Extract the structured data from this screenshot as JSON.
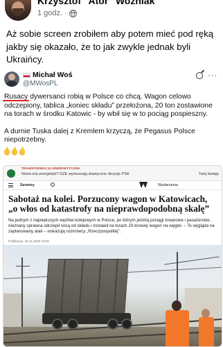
{
  "post": {
    "author": "Krzysztof \"Ator\" Woźniak",
    "time": "1 godz.",
    "text": "Aż sobie screen zrobiłem aby potem mieć pod ręką jakby się okazało, że to jak zwykle jednak byli Ukraińcy."
  },
  "tweet": {
    "name": "Michał Woś",
    "handle": "@MWosPL",
    "para1_highlight": "Rusacy",
    "para1_rest": " dywersanci robią w Polsce co chcą. Wagon celowo odczepiony, tablica „koniec składu” przełożona, 20 ton zostawione na torach w środku Katowic - by wbił się w to pociąg pospieszny.",
    "para2": "A durnie Tuska dalej z Kremlem krzyczą, że Pegasus Polsce niepotrzebny.",
    "emoji_count": 3
  },
  "article": {
    "tag": "TRANSFORMACJA ENERGETYCZNA",
    "topline": "Nowa era energetyki? OZE wymuszają drastyczne decyzje PSE",
    "topright": "Twój dostęp",
    "nav_serwisy": "Serwisy",
    "nav_wydarzenia": "Wydarzenia",
    "headline": "Sabotaż na kolei. Porzucony wagon w Katowicach, „o włos od katastrofy na nieprawdopodobną skalę”",
    "lead": "Na jednym z największych węzłów kolejowych w Polsce, po którym jeżdżą pociągi towarowe i pasażerskie, nieznany sprawca odczepił nocą od składu i zostawił na torach 20-tonowy wagon na węglel. – To wygląda na zaplanowany atak – wskazują rozmówcy „Rzeczpospolitej”.",
    "date": "Publikacja: 10.11.2025 10:00"
  },
  "colors": {
    "underline": "#e02020",
    "meta_gray": "#65676b"
  }
}
